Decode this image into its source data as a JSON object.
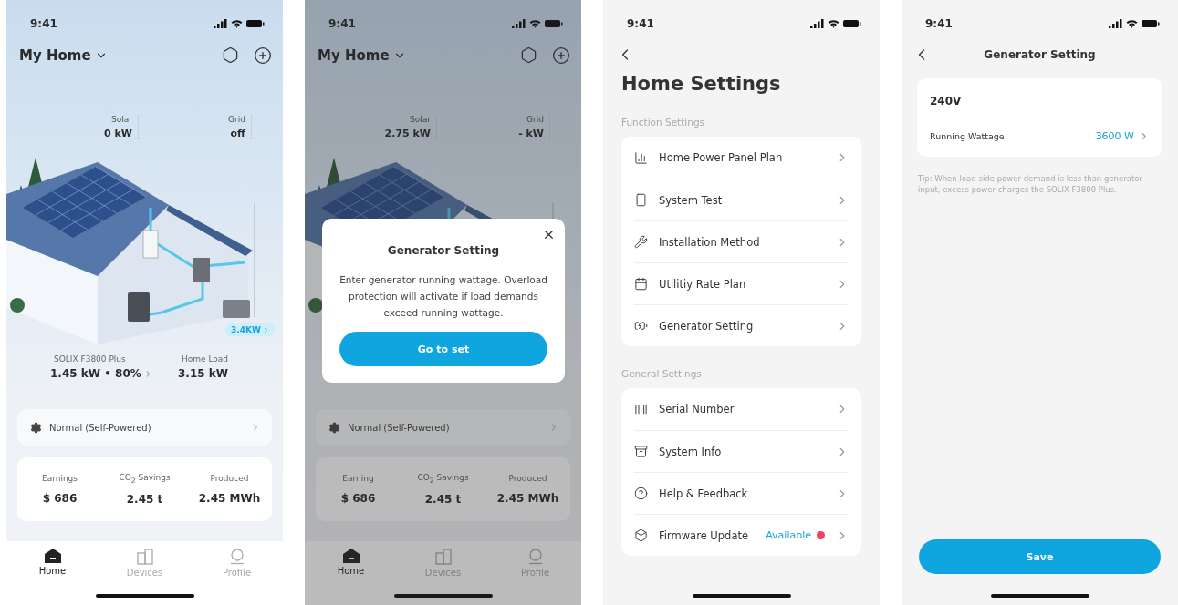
{
  "screens": [
    {
      "kind": "home",
      "time": "9:41",
      "title": "My Home",
      "flows": [
        {
          "label": "Solar",
          "value": "0 kW"
        },
        {
          "label": "Grid",
          "value": "off"
        }
      ],
      "generator_badge": "3.4KW",
      "stats": [
        {
          "label": "SOLIX F3800 Plus",
          "value": "1.45 kW • 80%",
          "link": true
        },
        {
          "label": "Home Load",
          "value": "3.15 kW",
          "link": false
        }
      ],
      "mode": "Normal (Self-Powered)",
      "summary": [
        {
          "label": "Earnings",
          "value": "$ 686"
        },
        {
          "label": "CO$_{2}$ Savings",
          "value": "2.45 t"
        },
        {
          "label": "Produced",
          "value": "2.45 MWh"
        }
      ],
      "nav": [
        {
          "label": "Home",
          "selected": true
        },
        {
          "label": "Devices",
          "selected": false
        },
        {
          "label": "Profile",
          "selected": false
        }
      ]
    },
    {
      "kind": "home",
      "time": "9:41",
      "title": "My Home",
      "flows": [
        {
          "label": "Solar",
          "value": "2.75 kW"
        },
        {
          "label": "Grid",
          "value": "- kW"
        }
      ],
      "mode": "Normal (Self-Powered)",
      "summary": [
        {
          "label": "Earning",
          "value": "$ 686"
        },
        {
          "label": "CO$_{2}$ Savings",
          "value": "2.45 t"
        },
        {
          "label": "Produced",
          "value": "2.45 MWh"
        }
      ],
      "nav": [
        {
          "label": "Home",
          "selected": true
        },
        {
          "label": "Devices",
          "selected": false
        },
        {
          "label": "Profile",
          "selected": false
        }
      ],
      "dialog": {
        "title": "Generator Setting",
        "message": "Enter generator running wattage. Overload protection will activate if load demands exceed running wattage.",
        "button": "Go to set"
      }
    },
    {
      "kind": "settings",
      "time": "9:41",
      "title": "Home Settings",
      "sections": [
        {
          "heading": "Function Settings",
          "items": [
            {
              "label": "Home Power Panel Plan",
              "alert": false
            },
            {
              "label": "System Test",
              "alert": false
            },
            {
              "label": "Installation Method",
              "alert": false
            },
            {
              "label": "Utilitiy Rate Plan",
              "alert": false
            },
            {
              "label": "Generator Setting",
              "alert": false
            }
          ]
        },
        {
          "heading": "General Settings",
          "items": [
            {
              "label": "Serial Number",
              "alert": false
            },
            {
              "label": "System Info",
              "alert": false
            },
            {
              "label": "Help & Feedback",
              "alert": false
            },
            {
              "label": "Firmware Update",
              "status": "Available",
              "alert": true
            }
          ]
        }
      ]
    },
    {
      "kind": "detail",
      "time": "9:41",
      "title": "Generator Setting",
      "voltage": "240V",
      "rows": [
        {
          "label": "Running Wattage",
          "value": "3600 W"
        }
      ],
      "tip": "Tip: When load-side power demand is less than generator input, excess power charges the SOLIX F3800 Plus.",
      "button": "Save"
    }
  ]
}
